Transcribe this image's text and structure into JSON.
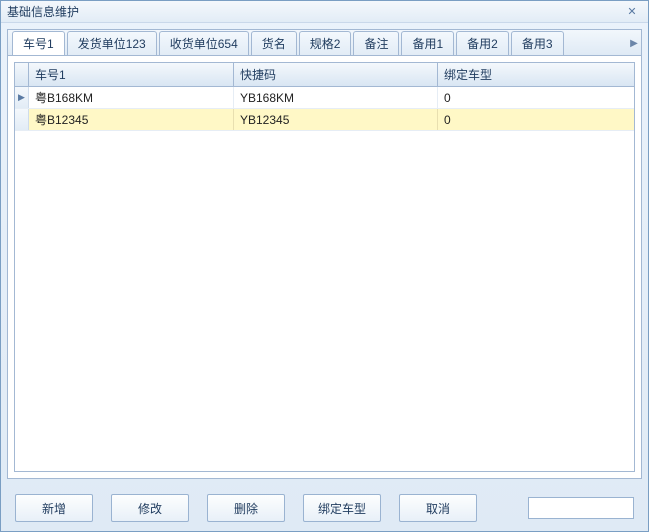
{
  "window": {
    "title": "基础信息维护"
  },
  "tabs": [
    {
      "label": "车号1",
      "active": true
    },
    {
      "label": "发货单位123"
    },
    {
      "label": "收货单位654"
    },
    {
      "label": "货名"
    },
    {
      "label": "规格2"
    },
    {
      "label": "备注"
    },
    {
      "label": "备用1"
    },
    {
      "label": "备用2"
    },
    {
      "label": "备用3"
    }
  ],
  "grid": {
    "columns": [
      "车号1",
      "快捷码",
      "绑定车型"
    ],
    "rows": [
      {
        "indicator": "▶",
        "cells": [
          "粤B168KM",
          "YB168KM",
          "0"
        ],
        "selected": false
      },
      {
        "indicator": "",
        "cells": [
          "粤B12345",
          "YB12345",
          "0"
        ],
        "selected": true
      }
    ]
  },
  "footer": {
    "buttons": [
      "新增",
      "修改",
      "删除",
      "绑定车型",
      "取消"
    ],
    "search_value": ""
  },
  "icons": {
    "close": "✕",
    "scroll_left": "◀",
    "scroll_right": "▶"
  }
}
